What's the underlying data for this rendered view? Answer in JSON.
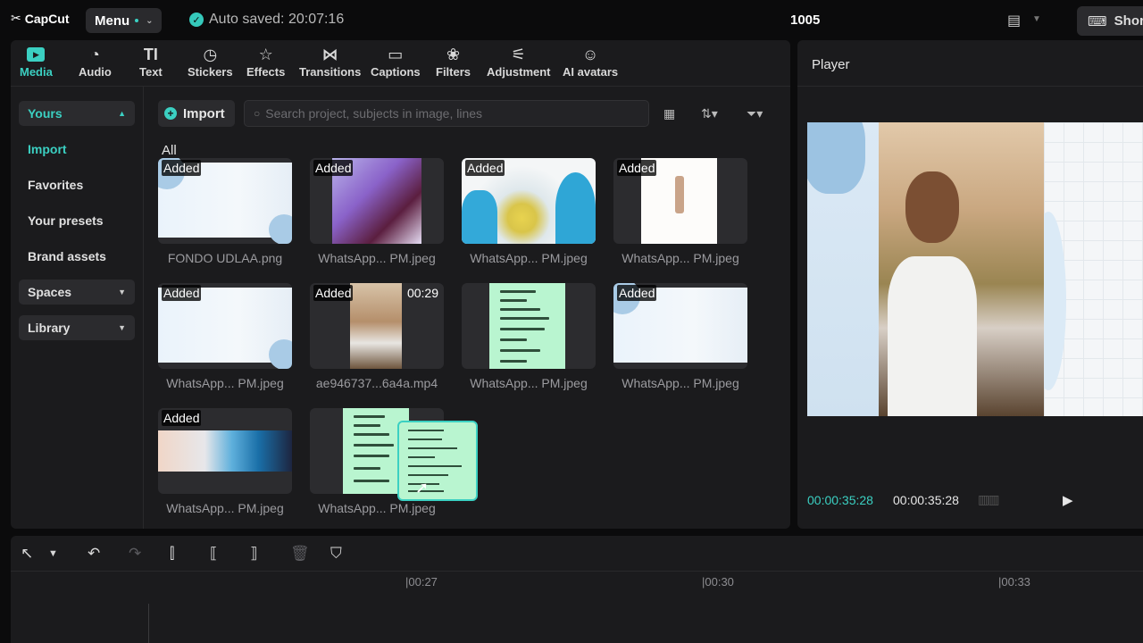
{
  "app": {
    "name": "CapCut",
    "menu_label": "Menu",
    "autosave": "Auto saved: 20:07:16",
    "project_title": "1005",
    "shortcuts_label": "Shor"
  },
  "tabs": [
    {
      "label": "Media",
      "icon": "media-icon"
    },
    {
      "label": "Audio",
      "icon": "audio-icon"
    },
    {
      "label": "Text",
      "icon": "text-icon"
    },
    {
      "label": "Stickers",
      "icon": "stickers-icon"
    },
    {
      "label": "Effects",
      "icon": "effects-icon"
    },
    {
      "label": "Transitions",
      "icon": "transitions-icon"
    },
    {
      "label": "Captions",
      "icon": "captions-icon"
    },
    {
      "label": "Filters",
      "icon": "filters-icon"
    },
    {
      "label": "Adjustment",
      "icon": "adjustment-icon"
    },
    {
      "label": "AI avatars",
      "icon": "ai-avatars-icon"
    }
  ],
  "sidebar": {
    "yours": "Yours",
    "import": "Import",
    "favorites": "Favorites",
    "presets": "Your presets",
    "brand": "Brand assets",
    "spaces": "Spaces",
    "library": "Library"
  },
  "toolbar": {
    "import_label": "Import",
    "search_placeholder": "Search project, subjects in image, lines",
    "section_label": "All"
  },
  "media": [
    {
      "name": "FONDO UDLAA.png",
      "added": "Added",
      "duration": ""
    },
    {
      "name": "WhatsApp... PM.jpeg",
      "added": "Added",
      "duration": ""
    },
    {
      "name": "WhatsApp... PM.jpeg",
      "added": "Added",
      "duration": ""
    },
    {
      "name": "WhatsApp... PM.jpeg",
      "added": "Added",
      "duration": ""
    },
    {
      "name": "WhatsApp... PM.jpeg",
      "added": "Added",
      "duration": ""
    },
    {
      "name": "ae946737...6a4a.mp4",
      "added": "Added",
      "duration": "00:29"
    },
    {
      "name": "WhatsApp... PM.jpeg",
      "added": "",
      "duration": ""
    },
    {
      "name": "WhatsApp... PM.jpeg",
      "added": "Added",
      "duration": ""
    },
    {
      "name": "WhatsApp... PM.jpeg",
      "added": "Added",
      "duration": ""
    },
    {
      "name": "WhatsApp... PM.jpeg",
      "added": "",
      "duration": ""
    }
  ],
  "player": {
    "title": "Player",
    "current_time": "00:00:35:28",
    "total_time": "00:00:35:28"
  },
  "timeline": {
    "ticks": [
      "|00:27",
      "|00:30",
      "|00:33"
    ]
  },
  "colors": {
    "accent": "#3bd0c2",
    "panel": "#1b1b1d",
    "background": "#0b0b0c"
  }
}
